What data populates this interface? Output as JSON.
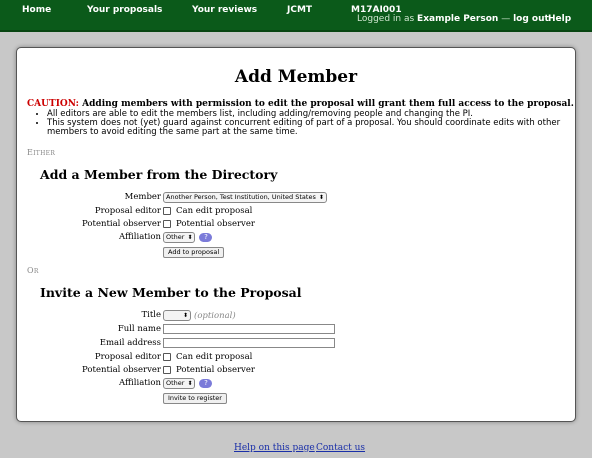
{
  "nav": {
    "home": "Home",
    "proposals": "Your proposals",
    "reviews": "Your reviews",
    "facility": "JCMT",
    "proposal_code": "M17AI001",
    "logged_in_as": "Logged in as",
    "user_name": "Example Person",
    "separator": "—",
    "logout": "log out",
    "help": "Help"
  },
  "page": {
    "title": "Add Member",
    "caution_label": "CAUTION:",
    "caution_text": "Adding members with permission to edit the proposal will grant them full access to the proposal.",
    "notes": [
      "All editors are able to edit the members list, including adding/removing people and changing the PI.",
      "This system does not (yet) guard against concurrent editing of part of a proposal. You should coordinate edits with other members to avoid editing the same part at the same time."
    ],
    "either": "Either",
    "or": "Or"
  },
  "directory_form": {
    "heading": "Add a Member from the Directory",
    "member_label": "Member",
    "member_value": "Another Person, Test Institution, United States",
    "editor_label": "Proposal editor",
    "editor_option": "Can edit proposal",
    "observer_label": "Potential observer",
    "observer_option": "Potential observer",
    "affiliation_label": "Affiliation",
    "affiliation_value": "Other",
    "help_mark": "?",
    "submit": "Add to proposal"
  },
  "invite_form": {
    "heading": "Invite a New Member to the Proposal",
    "title_label": "Title",
    "title_value": "",
    "title_hint": "(optional)",
    "name_label": "Full name",
    "name_value": "",
    "email_label": "Email address",
    "email_value": "",
    "editor_label": "Proposal editor",
    "editor_option": "Can edit proposal",
    "observer_label": "Potential observer",
    "observer_option": "Potential observer",
    "affiliation_label": "Affiliation",
    "affiliation_value": "Other",
    "help_mark": "?",
    "submit": "Invite to register"
  },
  "footer": {
    "help": "Help on this page",
    "contact": "Contact us"
  }
}
